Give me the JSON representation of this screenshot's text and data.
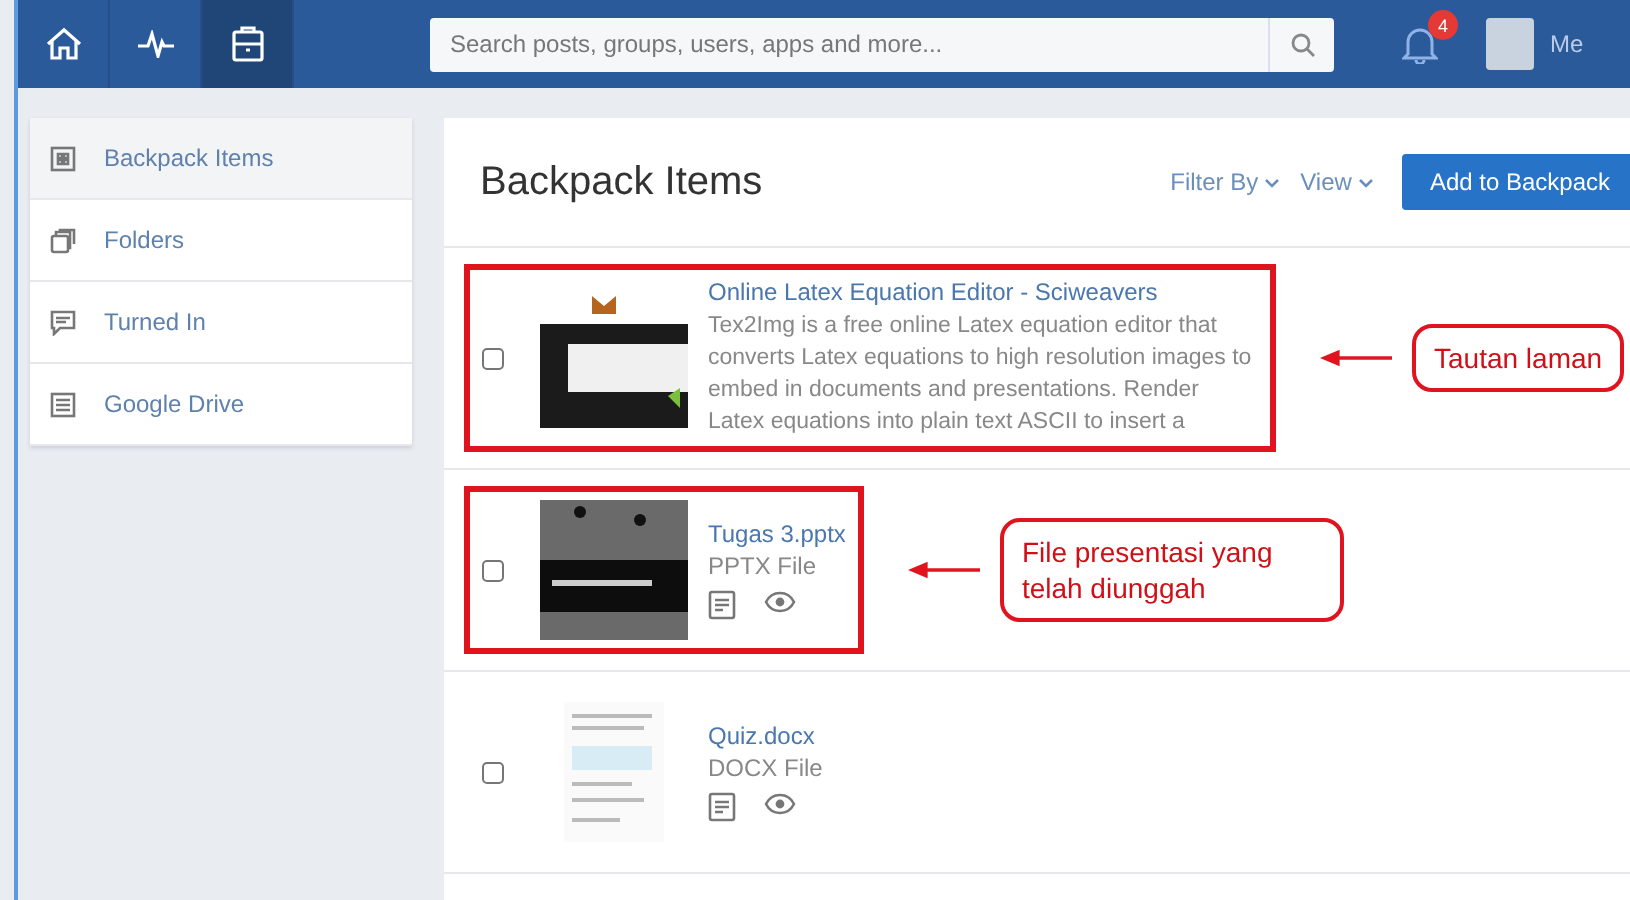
{
  "topbar": {
    "nav": [
      {
        "kind": "home",
        "selected": false
      },
      {
        "kind": "activity",
        "selected": false
      },
      {
        "kind": "backpack",
        "selected": true
      }
    ],
    "search": {
      "placeholder": "Search posts, groups, users, apps and more..."
    },
    "notifications": "4",
    "user": "Me"
  },
  "sidebar": {
    "items": [
      {
        "kind": "grid",
        "label": "Backpack Items",
        "selected": true
      },
      {
        "kind": "folders",
        "label": "Folders",
        "selected": false
      },
      {
        "kind": "chat",
        "label": "Turned In",
        "selected": false
      },
      {
        "kind": "doc",
        "label": "Google Drive",
        "selected": false
      }
    ]
  },
  "main": {
    "title": "Backpack Items",
    "filter": "Filter By",
    "view": "View",
    "add_button": "Add to Backpack",
    "items": [
      {
        "kind": "link",
        "title": "Online Latex Equation Editor - Sciweavers",
        "description": "Tex2Img is a free online Latex equation editor that converts Latex equations to high resolution images to embed in documents and presentations. Render Latex equations into plain text ASCII to insert a",
        "checked": false,
        "highlighted": true,
        "callout": "Tautan laman"
      },
      {
        "kind": "slides",
        "title": "Tugas 3.pptx",
        "type": "PPTX File",
        "checked": false,
        "highlighted": true,
        "callout": "File presentasi yang telah diunggah"
      },
      {
        "kind": "document",
        "title": "Quiz.docx",
        "type": "DOCX File",
        "checked": false,
        "highlighted": false
      }
    ]
  }
}
